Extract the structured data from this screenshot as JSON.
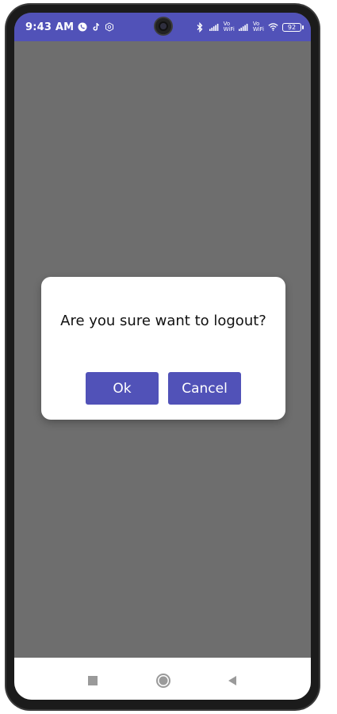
{
  "status_bar": {
    "time": "9:43 AM",
    "battery": "92",
    "vowifi_1_top": "Vo",
    "vowifi_1_bottom": "WiFi",
    "vowifi_2_top": "Vo",
    "vowifi_2_bottom": "WiFi",
    "icons": [
      "phone-call-icon",
      "tiktok-icon",
      "shield-icon",
      "camera-icon",
      "bluetooth-icon",
      "signal-icon",
      "wifi-icon",
      "battery-icon"
    ],
    "background": "#5152b8"
  },
  "dialog": {
    "message": "Are you sure want to logout?",
    "ok_label": "Ok",
    "cancel_label": "Cancel",
    "button_color": "#5152b8"
  },
  "overlay_color": "#6e6e6e",
  "nav_bar": {
    "icons": [
      "recent-apps-icon",
      "home-icon",
      "back-icon"
    ]
  }
}
